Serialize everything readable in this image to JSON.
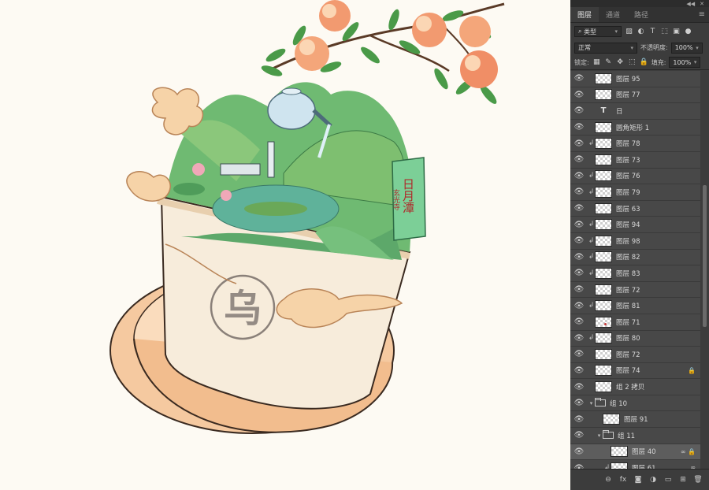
{
  "canvas": {
    "background": "#fdfaf3",
    "seal_char": "乌",
    "stone_text": "日月潭",
    "stone_subtext": "玄光寺"
  },
  "panel": {
    "tabs": [
      {
        "label": "图层",
        "active": true
      },
      {
        "label": "通道",
        "active": false
      },
      {
        "label": "路径",
        "active": false
      }
    ],
    "filter_type": "类型",
    "blend_mode": "正常",
    "opacity_label": "不透明度:",
    "opacity_value": "100%",
    "lock_label": "锁定:",
    "fill_label": "填充:",
    "fill_value": "100%",
    "layers": [
      {
        "name": "图层 95",
        "kind": "pixel",
        "indent": 0,
        "clip": false
      },
      {
        "name": "图层 77",
        "kind": "pixel",
        "indent": 0,
        "clip": false
      },
      {
        "name": "日",
        "kind": "text",
        "indent": 0,
        "clip": false
      },
      {
        "name": "圆角矩形 1",
        "kind": "shape",
        "indent": 0,
        "clip": false
      },
      {
        "name": "图层 78",
        "kind": "pixel",
        "indent": 0,
        "clip": true
      },
      {
        "name": "图层 73",
        "kind": "pixel",
        "indent": 0,
        "clip": false
      },
      {
        "name": "图层 76",
        "kind": "pixel",
        "indent": 0,
        "clip": true
      },
      {
        "name": "图层 79",
        "kind": "pixel",
        "indent": 0,
        "clip": true
      },
      {
        "name": "图层 63",
        "kind": "pixel",
        "indent": 0,
        "clip": false
      },
      {
        "name": "图层 94",
        "kind": "pixel",
        "indent": 0,
        "clip": true
      },
      {
        "name": "图层 98",
        "kind": "pixel",
        "indent": 0,
        "clip": true
      },
      {
        "name": "图层 82",
        "kind": "pixel",
        "indent": 0,
        "clip": true
      },
      {
        "name": "图层 83",
        "kind": "pixel",
        "indent": 0,
        "clip": true
      },
      {
        "name": "图层 72",
        "kind": "pixel",
        "indent": 0,
        "clip": false
      },
      {
        "name": "图层 81",
        "kind": "pixel",
        "indent": 0,
        "clip": true
      },
      {
        "name": "图层 71",
        "kind": "pixel-dot",
        "indent": 0,
        "clip": false
      },
      {
        "name": "图层 80",
        "kind": "pixel",
        "indent": 0,
        "clip": true
      },
      {
        "name": "图层 72",
        "kind": "pixel",
        "indent": 0,
        "clip": false
      },
      {
        "name": "图层 74",
        "kind": "pixel",
        "indent": 0,
        "clip": false,
        "right": "🔒"
      },
      {
        "name": "组 2 拷贝",
        "kind": "group-thumb",
        "indent": 0,
        "clip": false
      },
      {
        "name": "组 10",
        "kind": "folder",
        "indent": 0,
        "clip": false,
        "open": true
      },
      {
        "name": "图层 91",
        "kind": "pixel",
        "indent": 1,
        "clip": false
      },
      {
        "name": "组 11",
        "kind": "folder",
        "indent": 1,
        "clip": false,
        "open": true
      },
      {
        "name": "图层 40",
        "kind": "pixel",
        "indent": 2,
        "clip": false,
        "selected": true,
        "right": "∞ 🔒"
      },
      {
        "name": "图层 61",
        "kind": "pixel",
        "indent": 2,
        "clip": true,
        "right": "∞"
      }
    ]
  }
}
